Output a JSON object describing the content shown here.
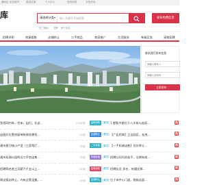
{
  "top": [
    "通州区",
    "定位城市",
    "登录注册",
    "个人中心",
    "发布信息",
    "手机访问"
  ],
  "logo": "库",
  "search": {
    "category": "请选择分类",
    "placeholder": "输入关键字开始搜索",
    "post_button": "发布免费信息"
  },
  "hotwords": [
    "热门搜索：",
    "招聘",
    "房产信息"
  ],
  "nav": [
    "招聘求职",
    "房屋租售",
    "店铺转让",
    "二手商品",
    "商家推广",
    "生活服务",
    "车辆买卖",
    "宠物家教"
  ],
  "sidebar": {
    "title": "联系我们发布信息",
    "name_placeholder": "请输入联系人",
    "phone_placeholder": "请输入手机号",
    "submit": "立即发布"
  },
  "left_list": [
    {
      "text": "急招网约车，货车，出行，往返…",
      "time": "22小时前"
    },
    {
      "text": "出租好位置房屋带装修急需找…",
      "time": "2天前"
    },
    {
      "text": "通州星河城小户型（三室两厅…",
      "time": "3天前"
    },
    {
      "text": "通州双湖公园附近二手房出售…",
      "time": "3天前"
    },
    {
      "text": "招聘两名普工月薪六千五以上…",
      "time": "4天前"
    },
    {
      "text": "周边饭店转让，内有全套设备，…",
      "time": "5天前"
    }
  ],
  "right_list": [
    {
      "tag": "招聘求职",
      "badge": "[置顶]",
      "text": "1 都智大楼位于八丰街与苗苑…"
    },
    {
      "tag": "店铺转让",
      "badge": "[置顶]",
      "text": "【广告招商】工业园区，宏地…"
    },
    {
      "tag": "二手商品",
      "badge": "[置顶]",
      "text": "【一手机械出售】优价转让…"
    },
    {
      "tag": "车辆买卖",
      "badge": "[置顶]",
      "text": "招聘公司司机若干，长期有效…"
    },
    {
      "tag": "招聘求职",
      "badge": "[置顶]",
      "text": "招聘店员 多名，待遇优厚…"
    },
    {
      "tag": "店铺转让",
      "badge": "[置顶]",
      "text": "位于市中心门面，临街店面…"
    }
  ],
  "colors": {
    "accent": "#d9334a",
    "tag_cyan": "#2eb5c9",
    "tag_blue": "#3b8ee0",
    "tag_purple": "#9a7ad8",
    "tag_red": "#e6475f"
  }
}
